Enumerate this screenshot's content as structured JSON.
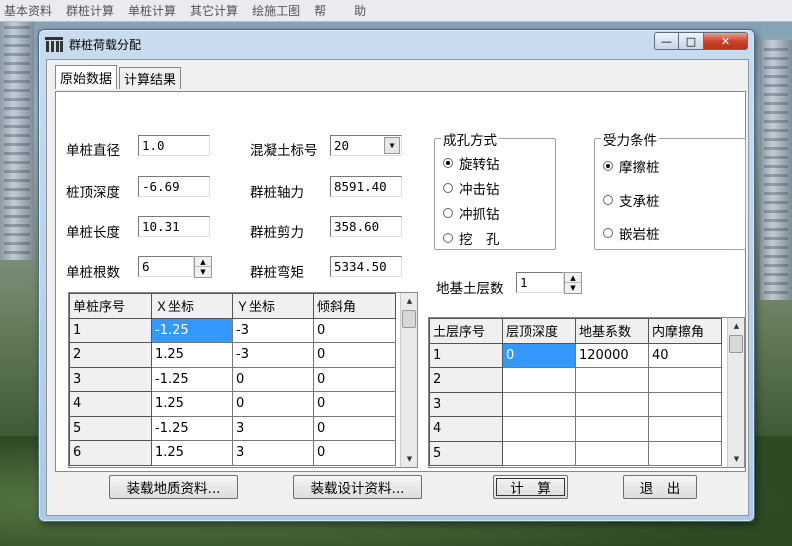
{
  "menubar": [
    "基本资料",
    "群桩计算",
    "单桩计算",
    "其它计算",
    "绘施工图",
    "帮",
    "助"
  ],
  "window": {
    "title": "群桩荷载分配",
    "controls": {
      "minimize": "—",
      "maximize": "□",
      "close": "✕"
    }
  },
  "tabs": [
    "原始数据",
    "计算结果"
  ],
  "left_fields": [
    {
      "label": "单桩直径",
      "value": "1.0"
    },
    {
      "label": "桩顶深度",
      "value": "-6.69"
    },
    {
      "label": "单桩长度",
      "value": "10.31"
    },
    {
      "label": "单桩根数",
      "value": "6"
    }
  ],
  "mid_fields": [
    {
      "label": "混凝土标号",
      "value": "20"
    },
    {
      "label": "群桩轴力",
      "value": "8591.40"
    },
    {
      "label": "群桩剪力",
      "value": "358.60"
    },
    {
      "label": "群桩弯矩",
      "value": "5334.50"
    }
  ],
  "hole_group": {
    "title": "成孔方式",
    "options": [
      "旋转钻",
      "冲击钻",
      "冲抓钻",
      "挖　孔"
    ],
    "selected": 0
  },
  "force_group": {
    "title": "受力条件",
    "options": [
      "摩擦桩",
      "支承桩",
      "嵌岩桩"
    ],
    "selected": 0
  },
  "soil_layers": {
    "label": "地基土层数",
    "value": "1"
  },
  "pile_table": {
    "headers": [
      "单桩序号",
      "Ｘ坐标",
      "Ｙ坐标",
      "倾斜角"
    ],
    "rows": [
      [
        "1",
        "-1.25",
        "-3",
        "0"
      ],
      [
        "2",
        "1.25",
        "-3",
        "0"
      ],
      [
        "3",
        "-1.25",
        "0",
        "0"
      ],
      [
        "4",
        "1.25",
        "0",
        "0"
      ],
      [
        "5",
        "-1.25",
        "3",
        "0"
      ],
      [
        "6",
        "1.25",
        "3",
        "0"
      ]
    ]
  },
  "soil_table": {
    "headers": [
      "土层序号",
      "层顶深度",
      "地基系数",
      "内摩擦角"
    ],
    "rows": [
      [
        "1",
        "0",
        "120000",
        "40"
      ],
      [
        "2",
        "",
        "",
        ""
      ],
      [
        "3",
        "",
        "",
        ""
      ],
      [
        "4",
        "",
        "",
        ""
      ],
      [
        "5",
        "",
        "",
        ""
      ]
    ]
  },
  "buttons": {
    "load_geo": "装载地质资料...",
    "load_design": "装载设计资料...",
    "calculate": "计　算",
    "exit": "退　出"
  },
  "icons": {
    "spin_up": "▲",
    "spin_down": "▼",
    "combo": "▼",
    "scroll_up": "▲",
    "scroll_down": "▼"
  }
}
